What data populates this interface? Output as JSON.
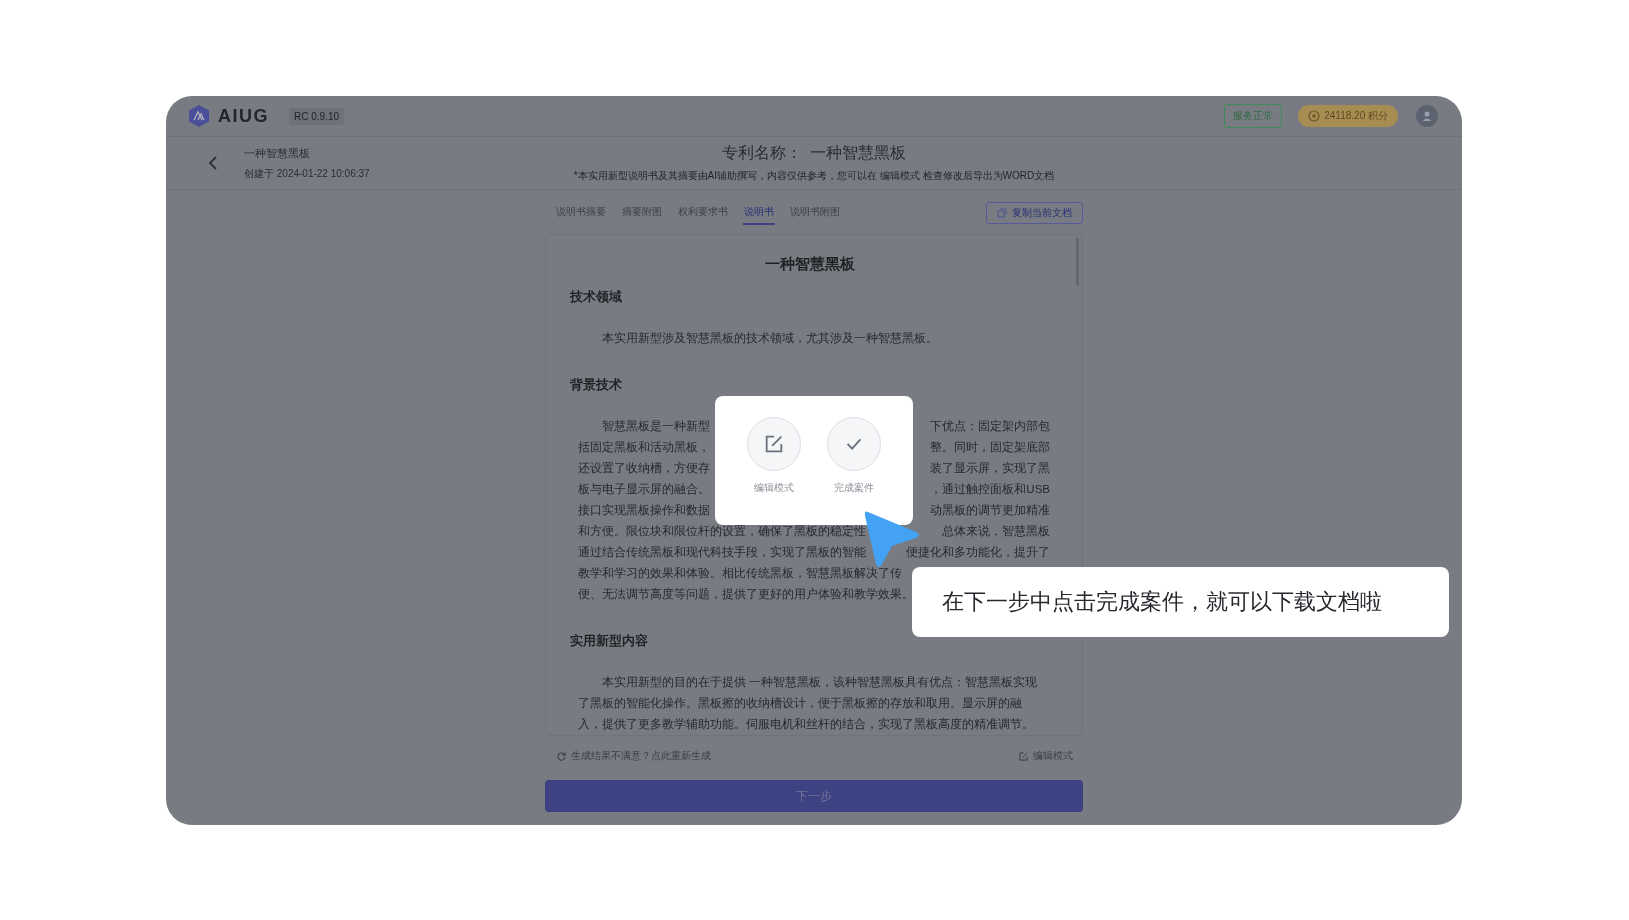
{
  "app": {
    "logo": "AIUG",
    "version": "RC 0.9.10",
    "service_status": "服务正常",
    "points": "24118.20 积分"
  },
  "case": {
    "name": "一种智慧黑板",
    "created": "创建于 2024-01-22 10:06:37"
  },
  "patent": {
    "label": "专利名称：",
    "name": "一种智慧黑板",
    "note": "*本实用新型说明书及其摘要由AI辅助撰写，内容仅供参考，您可以在 编辑模式 检查修改后导出为WORD文档"
  },
  "tabs": [
    {
      "label": "说明书摘要",
      "selected": false
    },
    {
      "label": "摘要附图",
      "selected": false
    },
    {
      "label": "权利要求书",
      "selected": false
    },
    {
      "label": "说明书",
      "selected": true
    },
    {
      "label": "说明书附图",
      "selected": false
    }
  ],
  "copy_button": "复制当前文档",
  "document": {
    "title": "一种智慧黑板",
    "sections": [
      {
        "heading": "技术领域",
        "paragraphs": [
          {
            "lines": [
              {
                "left": "本实用新型涉及智慧黑板的技术领域，尤其涉及一种智慧黑板。"
              }
            ]
          }
        ]
      },
      {
        "heading": "背景技术",
        "paragraphs": [
          {
            "lines": [
              {
                "left": "智慧黑板是一种新型",
                "right": "下优点：固定架内部包"
              },
              {
                "left": "括固定黑板和活动黑板，",
                "right": "整。同时，固定架底部"
              },
              {
                "left": "还设置了收纳槽，方便存",
                "right": "装了显示屏，实现了黑"
              },
              {
                "left": "板与电子显示屏的融合。",
                "right": "，通过触控面板和USB"
              },
              {
                "left": "接口实现黑板操作和数据",
                "right": "动黑板的调节更加精准"
              },
              {
                "left": "和方便。限位块和限位杆的设置，确保了黑板的稳定性",
                "right": "总体来说，智慧黑板"
              },
              {
                "left": "通过结合传统黑板和现代科技手段，实现了黑板的智能",
                "right": "便捷化和多功能化，提升了"
              },
              {
                "left": "教学和学习的效果和体验。相比传统黑板，智慧黑板解决了传"
              },
              {
                "left": "便、无法调节高度等问题，提供了更好的用户体验和教学效果。"
              }
            ]
          }
        ]
      },
      {
        "heading": "实用新型内容",
        "paragraphs": [
          {
            "lines": [
              {
                "left": "本实用新型的目的在于提供 一种智慧黑板，该种智慧黑板具有优点：智慧黑板实现"
              },
              {
                "left": "了黑板的智能化操作。黑板擦的收纳槽设计，便于黑板擦的存放和取用。显示屏的融"
              },
              {
                "left": "入，提供了更多教学辅助功能。伺服电机和丝杆的结合，实现了黑板高度的精准调节。"
              }
            ]
          }
        ]
      }
    ]
  },
  "footer": {
    "regenerate": "生成结果不满意？点此重新生成",
    "edit_mode": "编辑模式",
    "next_button": "下一步"
  },
  "popup": {
    "actions": [
      {
        "kind": "edit",
        "label": "编辑模式"
      },
      {
        "kind": "done",
        "label": "完成案件"
      }
    ]
  },
  "tooltip": "在下一步中点击完成案件，就可以下载文档啦"
}
